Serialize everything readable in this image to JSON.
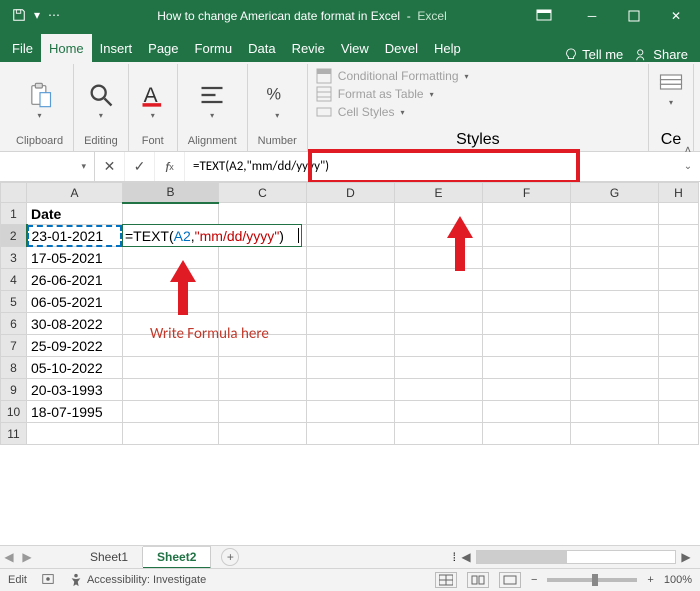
{
  "titlebar": {
    "title_main": "How to change American date format in Excel",
    "title_app": "Excel"
  },
  "tabs": {
    "file": "File",
    "home": "Home",
    "insert": "Insert",
    "page": "Page",
    "formu": "Formu",
    "data": "Data",
    "revie": "Revie",
    "view": "View",
    "devel": "Devel",
    "help": "Help",
    "tellme": "Tell me",
    "share": "Share"
  },
  "ribbon": {
    "clipboard": "Clipboard",
    "editing": "Editing",
    "font": "Font",
    "alignment": "Alignment",
    "number": "Number",
    "styles": "Styles",
    "cond_format": "Conditional Formatting",
    "format_table": "Format as Table",
    "cell_styles": "Cell Styles",
    "cells": "Ce"
  },
  "namebox": "",
  "formula_bar": "=TEXT(A2,\"mm/dd/yyyy\")",
  "formula_parts": {
    "pre": "=TEXT(",
    "ref": "A2",
    "mid": ",\"",
    "quoted": "mm/dd/yyyy",
    "post": "\")"
  },
  "columns": [
    "A",
    "B",
    "C",
    "D",
    "E",
    "F",
    "G",
    "H"
  ],
  "rows": [
    {
      "n": "1",
      "A": "Date",
      "bold": true
    },
    {
      "n": "2",
      "A": "23-01-2021"
    },
    {
      "n": "3",
      "A": "17-05-2021"
    },
    {
      "n": "4",
      "A": "26-06-2021"
    },
    {
      "n": "5",
      "A": "06-05-2021"
    },
    {
      "n": "6",
      "A": "30-08-2022"
    },
    {
      "n": "7",
      "A": "25-09-2022"
    },
    {
      "n": "8",
      "A": "05-10-2022"
    },
    {
      "n": "9",
      "A": "20-03-1993"
    },
    {
      "n": "10",
      "A": "18-07-1995"
    },
    {
      "n": "11",
      "A": ""
    }
  ],
  "annotation": {
    "text": "Write Formula here"
  },
  "sheets": {
    "s1": "Sheet1",
    "s2": "Sheet2"
  },
  "statusbar": {
    "mode": "Edit",
    "access": "Accessibility: Investigate",
    "zoom": "100%"
  }
}
